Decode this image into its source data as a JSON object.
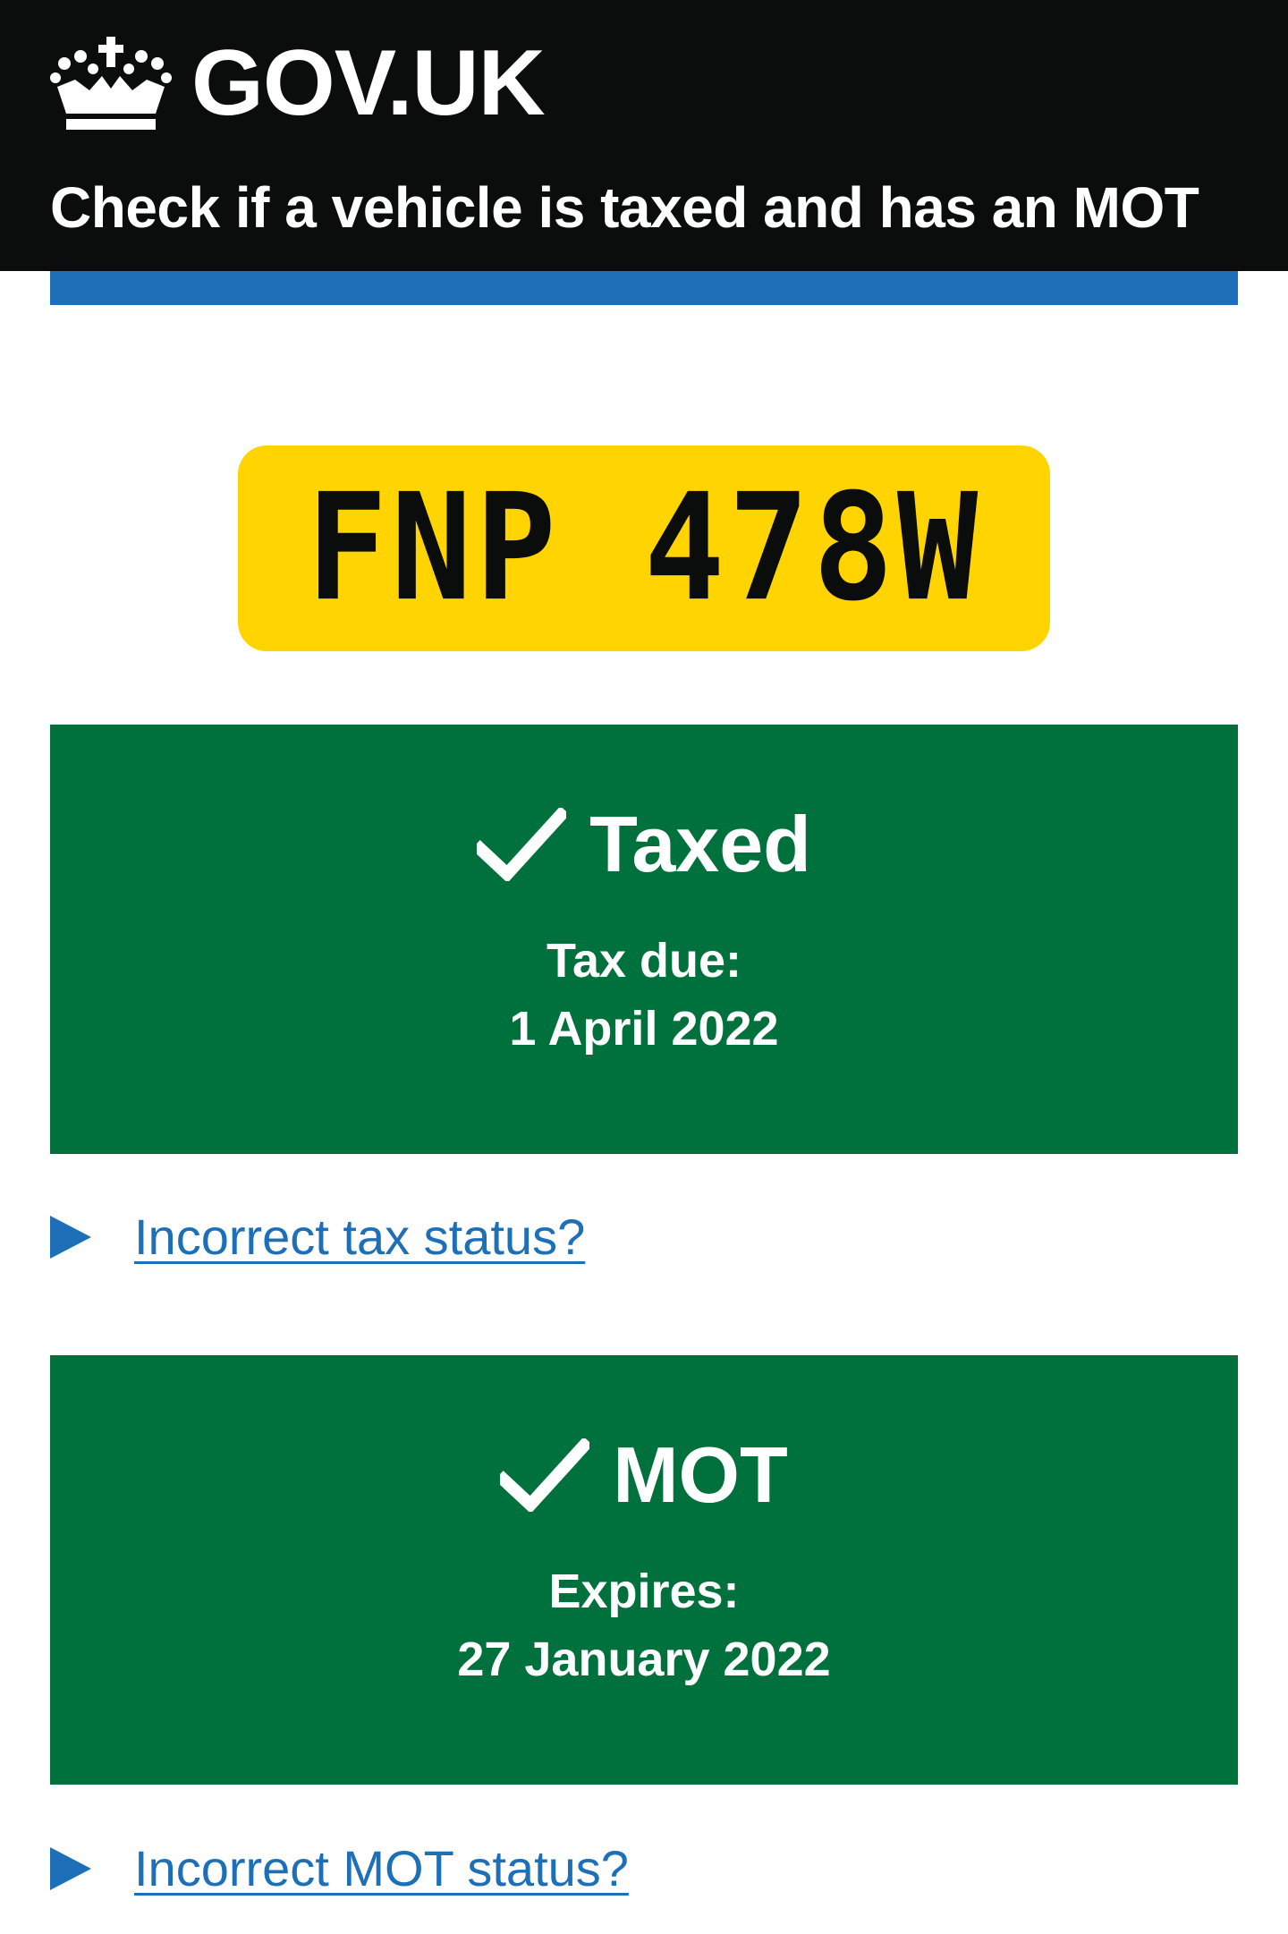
{
  "header": {
    "logo_text": "GOV.UK",
    "service_name": "Check if a vehicle is taxed and has an MOT"
  },
  "vehicle": {
    "registration": "FNP 478W"
  },
  "tax": {
    "status": "Taxed",
    "label": "Tax due:",
    "date": "1 April 2022",
    "link": "Incorrect tax status?"
  },
  "mot": {
    "status": "MOT",
    "label": "Expires:",
    "date": "27 January 2022",
    "link": "Incorrect MOT status?"
  },
  "colors": {
    "header_bg": "#0b0c0c",
    "accent_blue": "#1d70b8",
    "plate_yellow": "#ffd400",
    "status_green": "#00703c"
  }
}
